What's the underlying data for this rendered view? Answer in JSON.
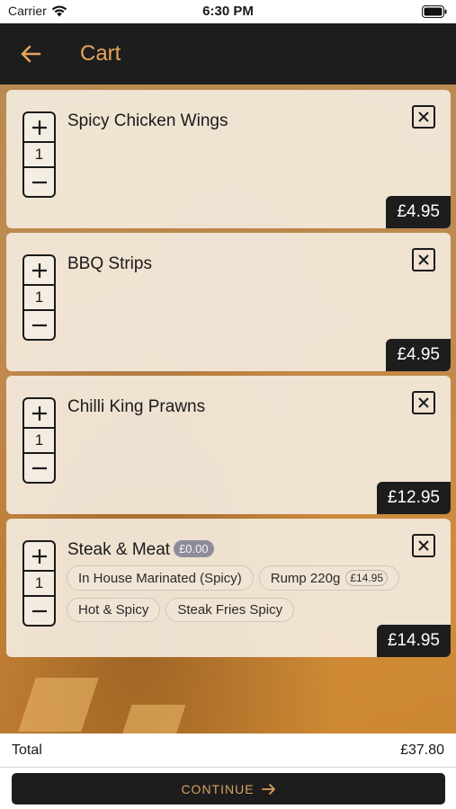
{
  "status_bar": {
    "carrier": "Carrier",
    "time": "6:30 PM"
  },
  "header": {
    "title": "Cart"
  },
  "cart": {
    "items": [
      {
        "name": "Spicy Chicken Wings",
        "qty": "1",
        "price": "£4.95"
      },
      {
        "name": "BBQ Strips",
        "qty": "1",
        "price": "£4.95"
      },
      {
        "name": "Chilli King Prawns",
        "qty": "1",
        "price": "£12.95"
      },
      {
        "name": "Steak & Meat",
        "base_price": "£0.00",
        "qty": "1",
        "price": "£14.95",
        "options": [
          {
            "label": "In House Marinated (Spicy)"
          },
          {
            "label": "Rump 220g",
            "price": "£14.95"
          },
          {
            "label": "Hot & Spicy"
          },
          {
            "label": "Steak Fries Spicy"
          }
        ]
      }
    ]
  },
  "footer": {
    "total_label": "Total",
    "total_value": "£37.80",
    "continue_label": "CONTINUE"
  },
  "colors": {
    "accent": "#e7a55a",
    "dark": "#1d1d1d",
    "card": "#f3e9dd"
  }
}
